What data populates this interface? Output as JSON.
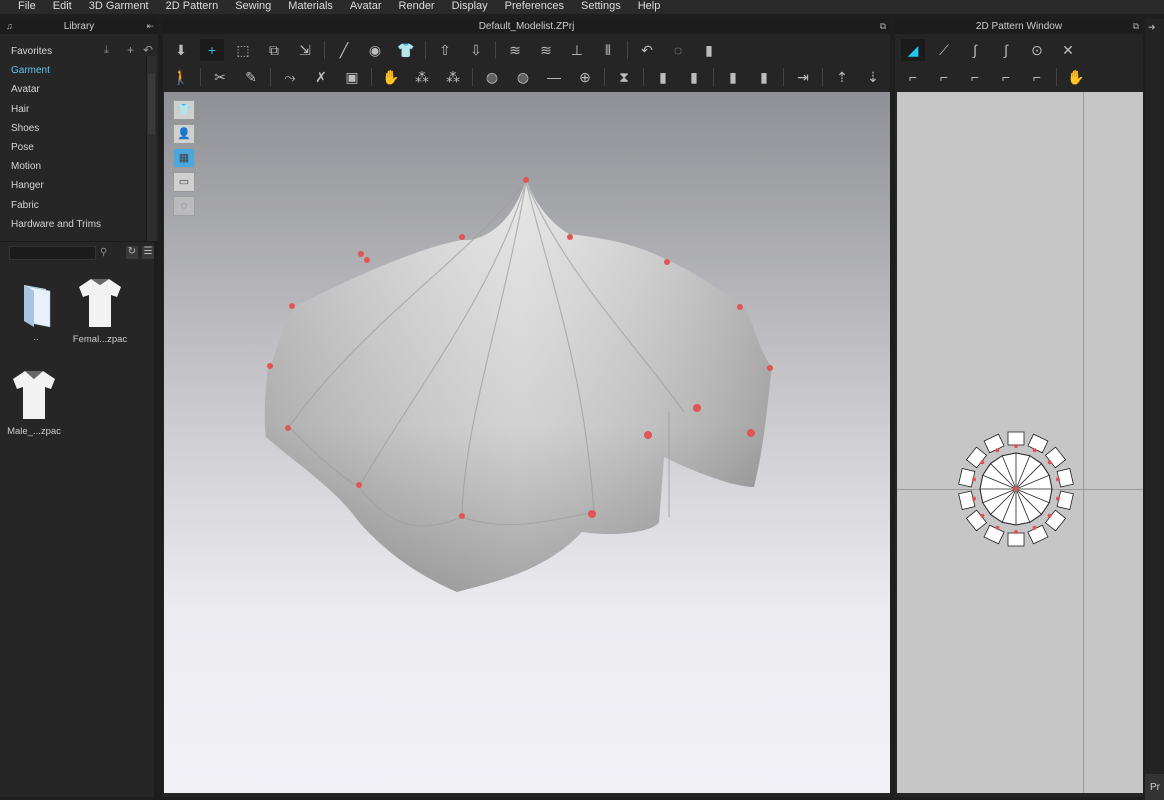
{
  "menu": [
    "File",
    "Edit",
    "3D Garment",
    "2D Pattern",
    "Sewing",
    "Materials",
    "Avatar",
    "Render",
    "Display",
    "Preferences",
    "Settings",
    "Help"
  ],
  "library": {
    "title": "Library",
    "categories": [
      "Favorites",
      "Garment",
      "Avatar",
      "Hair",
      "Shoes",
      "Pose",
      "Motion",
      "Hanger",
      "Fabric",
      "Hardware and Trims"
    ],
    "selected": "Garment",
    "search_value": "",
    "files": [
      {
        "label": "..",
        "icon": "folder-icon"
      },
      {
        "label": "Femal...zpac",
        "icon": "tshirt-icon"
      },
      {
        "label": "Male_...zpac",
        "icon": "tshirt-icon"
      }
    ]
  },
  "view3d": {
    "title": "Default_Modelist.ZPrj",
    "row1": [
      "⬇",
      "+",
      "⬚",
      "⧉",
      "⇲",
      "|",
      "╱",
      "◉",
      "👕",
      "|",
      "⇧",
      "⇩",
      "|",
      "≋",
      "≋",
      "⊥",
      "⫴",
      "|",
      "↶",
      "◌",
      "▮"
    ],
    "row2": [
      "🚶",
      "|",
      "✂",
      "✎",
      "|",
      "⤳",
      "✗",
      "▣",
      "|",
      "✋",
      "⁂",
      "⁂",
      "|",
      "◍",
      "◍",
      "—",
      "⊕",
      "|",
      "⧗",
      "|",
      "▮",
      "▮",
      "|",
      "▮",
      "▮",
      "|",
      "⇥",
      "|",
      "⇡",
      "⇣"
    ],
    "side_tools": [
      "garment-view",
      "avatar-view",
      "fabric-view",
      "flat-view",
      "texture-view"
    ]
  },
  "view2d": {
    "title": "2D Pattern Window",
    "row1": [
      "◢",
      "⟋",
      "∫",
      "∫",
      "⊙",
      "✕"
    ],
    "row2": [
      "⌐",
      "⌐",
      "⌐",
      "⌐",
      "⌐",
      "|",
      "✋"
    ]
  },
  "right_tab": "Pr",
  "colors": {
    "accent": "#5fc6f0",
    "pin": "#e05555"
  }
}
